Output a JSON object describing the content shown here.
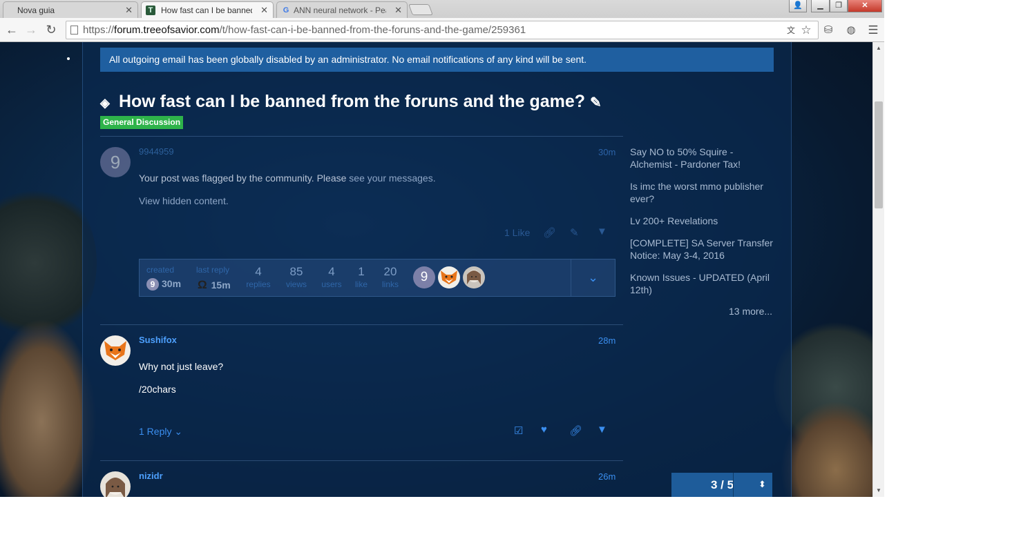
{
  "browser": {
    "tabs": [
      {
        "label": "Nova guia",
        "favicon": ""
      },
      {
        "label": "How fast can I be banned",
        "favicon": "T"
      },
      {
        "label": "ANN neural network - Pea",
        "favicon": "G"
      }
    ],
    "url_prefix": "https://",
    "url_host": "forum.treeofsavior.com",
    "url_path": "/t/how-fast-can-i-be-banned-from-the-foruns-and-the-game/259361"
  },
  "banner": "All outgoing email has been globally disabled by an administrator. No email notifications of any kind will be sent.",
  "topic": {
    "title": "How fast can I be banned from the foruns and the game?",
    "category": "General Discussion",
    "category_color": "#2eb34a"
  },
  "posts": [
    {
      "avatar_letter": "9",
      "username": "9944959",
      "time": "30m",
      "text_lead": "Your post was flagged by the community. Please",
      "text_link": "see your messages.",
      "hidden_link": "View hidden content.",
      "likes": "1 Like"
    },
    {
      "username": "Sushifox",
      "time": "28m",
      "line1": "Why not just leave?",
      "line2": "/20chars",
      "replies": "1 Reply"
    },
    {
      "username": "nizidr",
      "time": "26m"
    }
  ],
  "topic_map": {
    "created_label": "created",
    "created_letter": "9",
    "created_value": "30m",
    "last_reply_label": "last reply",
    "last_reply_glyph": "Ω",
    "last_reply_value": "15m",
    "stats": [
      {
        "num": "4",
        "label": "replies"
      },
      {
        "num": "85",
        "label": "views"
      },
      {
        "num": "4",
        "label": "users"
      },
      {
        "num": "1",
        "label": "like"
      },
      {
        "num": "20",
        "label": "links"
      }
    ],
    "participant_letter": "9"
  },
  "suggested": [
    "Say NO to 50% Squire - Alchemist - Pardoner Tax!",
    "Is imc the worst mmo publisher ever?",
    "Lv 200+ Revelations",
    "[COMPLETE] SA Server Transfer Notice: May 3-4, 2016",
    "Known Issues - UPDATED (April 12th)"
  ],
  "more_link": "13 more...",
  "progress": "3 / 5"
}
